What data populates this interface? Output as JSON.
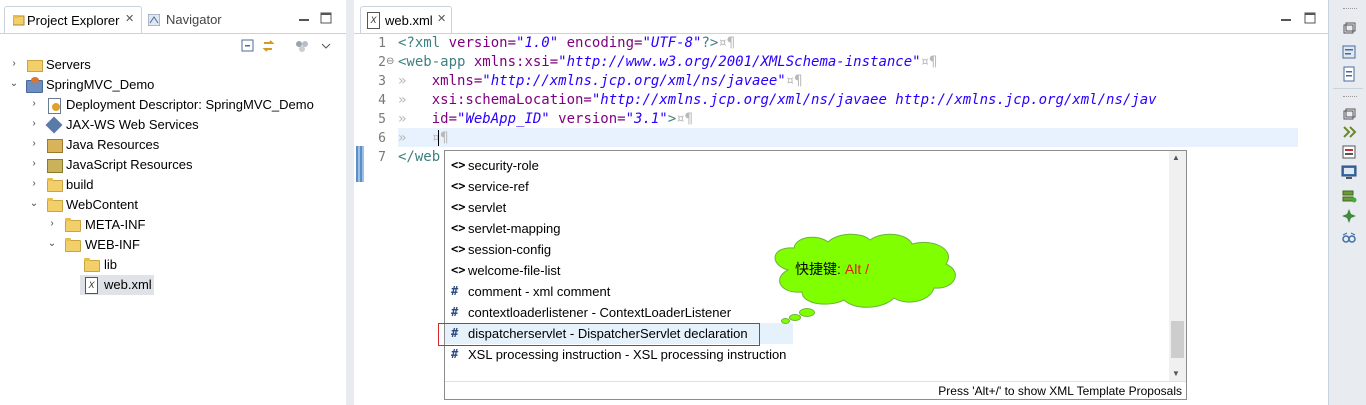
{
  "left_panel": {
    "tabs": [
      {
        "label": "Project Explorer",
        "close": "✕"
      },
      {
        "label": "Navigator",
        "close": ""
      }
    ],
    "tree": [
      {
        "label": "Servers",
        "icon": "servers-folder-icon",
        "twisty": "›"
      },
      {
        "label": "SpringMVC_Demo",
        "icon": "project-icon",
        "twisty": "⌄"
      },
      {
        "label": "Deployment Descriptor: SpringMVC_Demo",
        "icon": "deployment-descriptor-icon",
        "twisty": "›"
      },
      {
        "label": "JAX-WS Web Services",
        "icon": "jaxws-icon",
        "twisty": "›"
      },
      {
        "label": "Java Resources",
        "icon": "java-resources-icon",
        "twisty": "›"
      },
      {
        "label": "JavaScript Resources",
        "icon": "javascript-resources-icon",
        "twisty": "›"
      },
      {
        "label": "build",
        "icon": "folder-icon",
        "twisty": "›"
      },
      {
        "label": "WebContent",
        "icon": "folder-icon",
        "twisty": "⌄"
      },
      {
        "label": "META-INF",
        "icon": "folder-icon",
        "twisty": "›"
      },
      {
        "label": "WEB-INF",
        "icon": "folder-icon",
        "twisty": "⌄"
      },
      {
        "label": "lib",
        "icon": "folder-icon",
        "twisty": ""
      },
      {
        "label": "web.xml",
        "icon": "xml-file-icon",
        "twisty": ""
      }
    ]
  },
  "editor": {
    "tab": {
      "label": "web.xml",
      "close": "✕"
    },
    "line_numbers": [
      "1",
      "2",
      "3",
      "4",
      "5",
      "6",
      "7"
    ],
    "fold_marker": "⊖",
    "lines": {
      "l1": {
        "open": "<?xml",
        "a1": " version=",
        "v1": "\"1.0\"",
        "a2": " encoding=",
        "v2": "\"UTF-8\"",
        "close": "?>",
        "ws": "¤¶"
      },
      "l2": {
        "open": "<web-app",
        "a1": " xmlns:xsi=",
        "v1": "\"http://www.w3.org/2001/XMLSchema-instance\"",
        "ws": "¤¶"
      },
      "l3": {
        "indent": "»   ",
        "a1": "xmlns=",
        "v1": "\"http://xmlns.jcp.org/xml/ns/javaee\"",
        "ws": "¤¶"
      },
      "l4": {
        "indent": "»   ",
        "a1": "xsi:schemaLocation=",
        "v1": "\"http://xmlns.jcp.org/xml/ns/javaee http://xmlns.jcp.org/xml/ns/jav"
      },
      "l5": {
        "indent": "»   ",
        "a1": "id=",
        "v1": "\"WebApp_ID\"",
        "a2": " version=",
        "v2": "\"3.1\"",
        "close": ">",
        "ws": "¤¶"
      },
      "l6": {
        "indent": "»   ",
        "ws": "¤¶"
      },
      "l7": {
        "text": "</web"
      }
    }
  },
  "content_assist": {
    "items": [
      {
        "icon": "<>",
        "label": "security-role"
      },
      {
        "icon": "<>",
        "label": "service-ref"
      },
      {
        "icon": "<>",
        "label": "servlet"
      },
      {
        "icon": "<>",
        "label": "servlet-mapping"
      },
      {
        "icon": "<>",
        "label": "session-config"
      },
      {
        "icon": "<>",
        "label": "welcome-file-list"
      },
      {
        "icon": "#",
        "label": "comment - xml comment"
      },
      {
        "icon": "#",
        "label": "contextloaderlistener - ContextLoaderListener"
      },
      {
        "icon": "#",
        "label": "dispatcherservlet - DispatcherServlet declaration"
      },
      {
        "icon": "#",
        "label": "XSL processing instruction - XSL processing instruction"
      }
    ],
    "status": "Press 'Alt+/' to show XML Template Proposals",
    "scroll_up": "▲",
    "scroll_down": "▼"
  },
  "callout": {
    "prefix": "快捷键:",
    "key": "Alt /",
    "fill_color": "#80ff00",
    "key_color": "#e81818"
  },
  "colors": {
    "tag": "#3f7f7f",
    "attribute": "#7f007f",
    "value": "#2a00ff",
    "highlight_border": "#d9262b"
  }
}
